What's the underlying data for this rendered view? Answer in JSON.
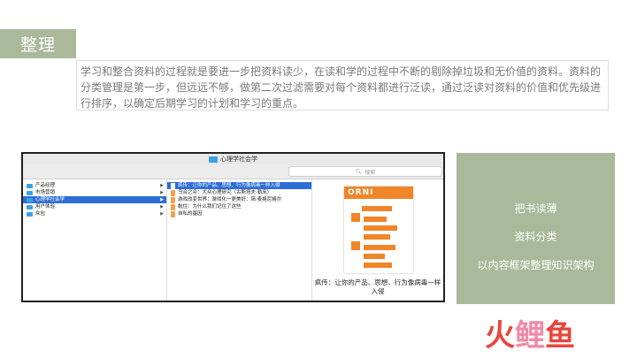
{
  "section_title": "整理",
  "intro_text": "学习和整合资料的过程就是要进一步把资料读少，在读和学的过程中不断的剔除掉垃圾和无价值的资料。资料的分类管理是第一步，但远远不够，做第二次过滤需要对每个资料都进行泛读，通过泛读对资料的价值和优先级进行排序，以确定后期学习的计划和学习的重点。",
  "finder": {
    "window_title": "心理学社会学",
    "search_placeholder": "搜索",
    "column1": [
      {
        "label": "产品经理",
        "selected": false
      },
      {
        "label": "市场营销",
        "selected": false
      },
      {
        "label": "心理学社会学",
        "selected": true
      },
      {
        "label": "用户体验",
        "selected": false
      },
      {
        "label": "众包",
        "selected": false
      }
    ],
    "column2": [
      {
        "label": "疯传：让你的产品、思想、行为像病毒一样入侵",
        "selected": true
      },
      {
        "label": "乌合之众：大众心理研究（古斯塔夫·勒庞）",
        "selected": false
      },
      {
        "label": "游戏改变世界：游戏化一更美好：简·麦格尼格尔",
        "selected": false
      },
      {
        "label": "黏住：为什么我们记住了这些",
        "selected": false
      },
      {
        "label": "自私的基因",
        "selected": false
      }
    ],
    "preview_cover_text": "ORNI",
    "preview_caption": "疯传：让你的产品、思想、行为像病毒一样入侵"
  },
  "panel": {
    "lines": [
      "把书读薄",
      "资料分类",
      "以内容框架整理知识架构"
    ],
    "bg_color": "#a9b99a"
  },
  "logo": {
    "chars": [
      "火",
      "鲤",
      "鱼"
    ],
    "colors": [
      "#e8453c",
      "#f08aa8",
      "#e8453c"
    ]
  }
}
